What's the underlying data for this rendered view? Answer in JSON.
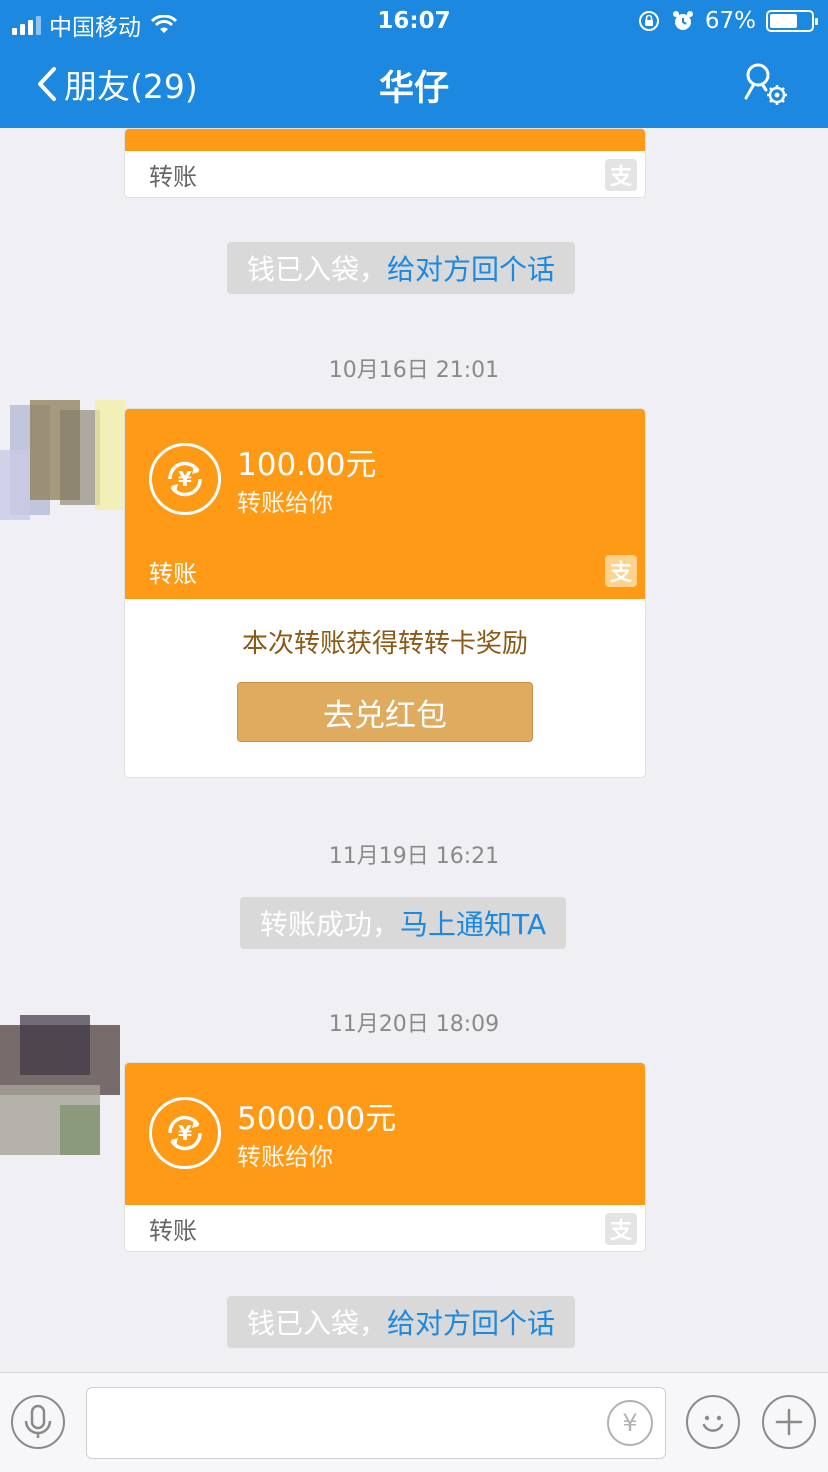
{
  "status": {
    "carrier": "中国移动",
    "time": "16:07",
    "battery": "67%",
    "battery_level": 0.67
  },
  "nav": {
    "back_label": "朋友(29)",
    "title": "华仔"
  },
  "messages": {
    "transfer_top": {
      "label": "转账"
    },
    "notice_1": {
      "text": "钱已入袋，",
      "link": "给对方回个话"
    },
    "time_1": "10月16日 21:01",
    "transfer_1": {
      "amount": "100.00元",
      "subtitle": "转账给你",
      "label": "转账",
      "reward_text": "本次转账获得转转卡奖励",
      "redeem_button": "去兑红包"
    },
    "time_2": "11月19日 16:21",
    "notice_2": {
      "text": "转账成功，",
      "link": "马上通知TA"
    },
    "time_3": "11月20日 18:09",
    "transfer_2": {
      "amount": "5000.00元",
      "subtitle": "转账给你",
      "label": "转账"
    },
    "notice_3": {
      "text": "钱已入袋，",
      "link": "给对方回个话"
    }
  },
  "input": {
    "placeholder": ""
  },
  "icons": {
    "alipay_glyph": "支",
    "yen_glyph": "¥"
  },
  "colors": {
    "header": "#1c88e0",
    "transfer_orange": "#ff9a17",
    "redeem_button": "#dfab5e",
    "link": "#1c88e0"
  }
}
